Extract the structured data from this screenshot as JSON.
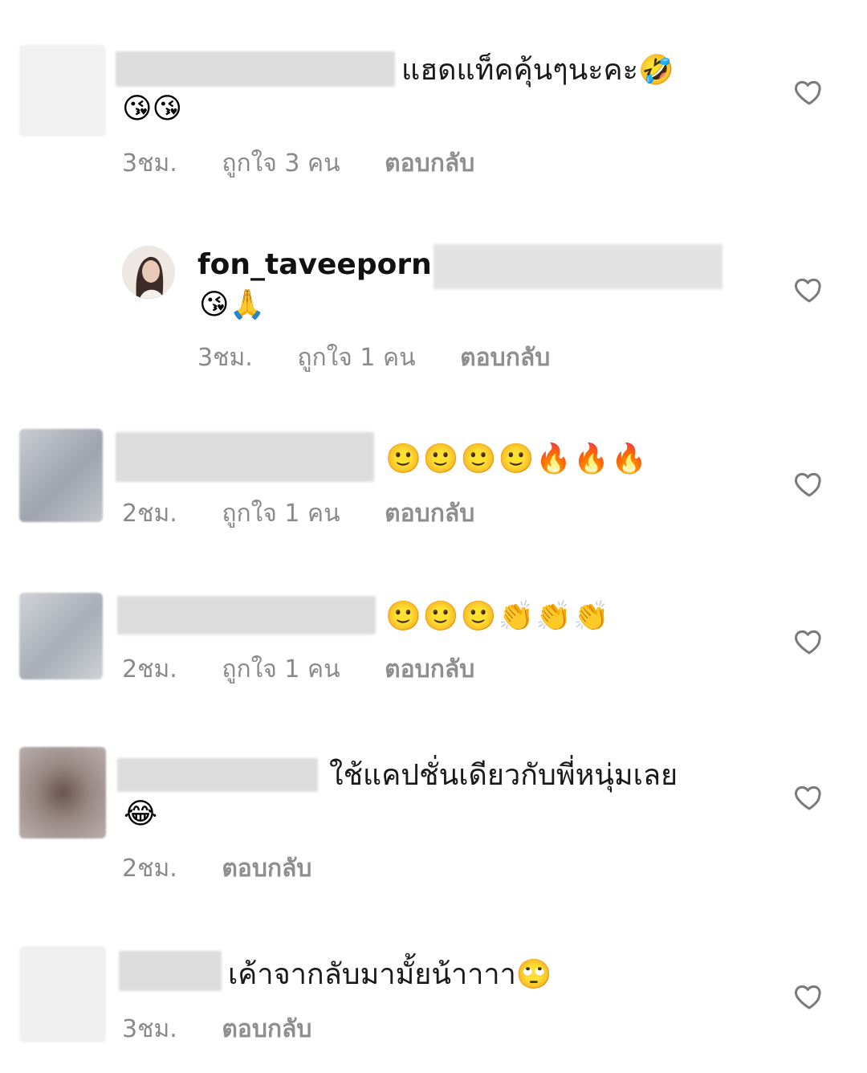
{
  "comments": [
    {
      "text": "แฮดแท็คคุ้นๆนะคะ🤣",
      "emoji": "😘😘",
      "time": "3ชม.",
      "likes": "ถูกใจ 3 คน",
      "reply": "ตอบกลับ"
    },
    {
      "username": "fon_taveeporn",
      "emoji": "😘🙏",
      "time": "3ชม.",
      "likes": "ถูกใจ 1 คน",
      "reply": "ตอบกลับ"
    },
    {
      "emoji": "🙂🙂🙂🙂🔥🔥🔥",
      "time": "2ชม.",
      "likes": "ถูกใจ 1 คน",
      "reply": "ตอบกลับ"
    },
    {
      "emoji": "🙂🙂🙂👏👏👏",
      "time": "2ชม.",
      "likes": "ถูกใจ 1 คน",
      "reply": "ตอบกลับ"
    },
    {
      "text": "ใช้แคปชั่นเดียวกับพี่หนุ่มเลย",
      "emoji": "😂",
      "time": "2ชม.",
      "reply": "ตอบกลับ"
    },
    {
      "text": "เค้าจากลับมามั้ยน้าาาา🙄",
      "time": "3ชม.",
      "reply": "ตอบกลับ"
    }
  ],
  "icons": {
    "like": "heart-outline-icon"
  }
}
